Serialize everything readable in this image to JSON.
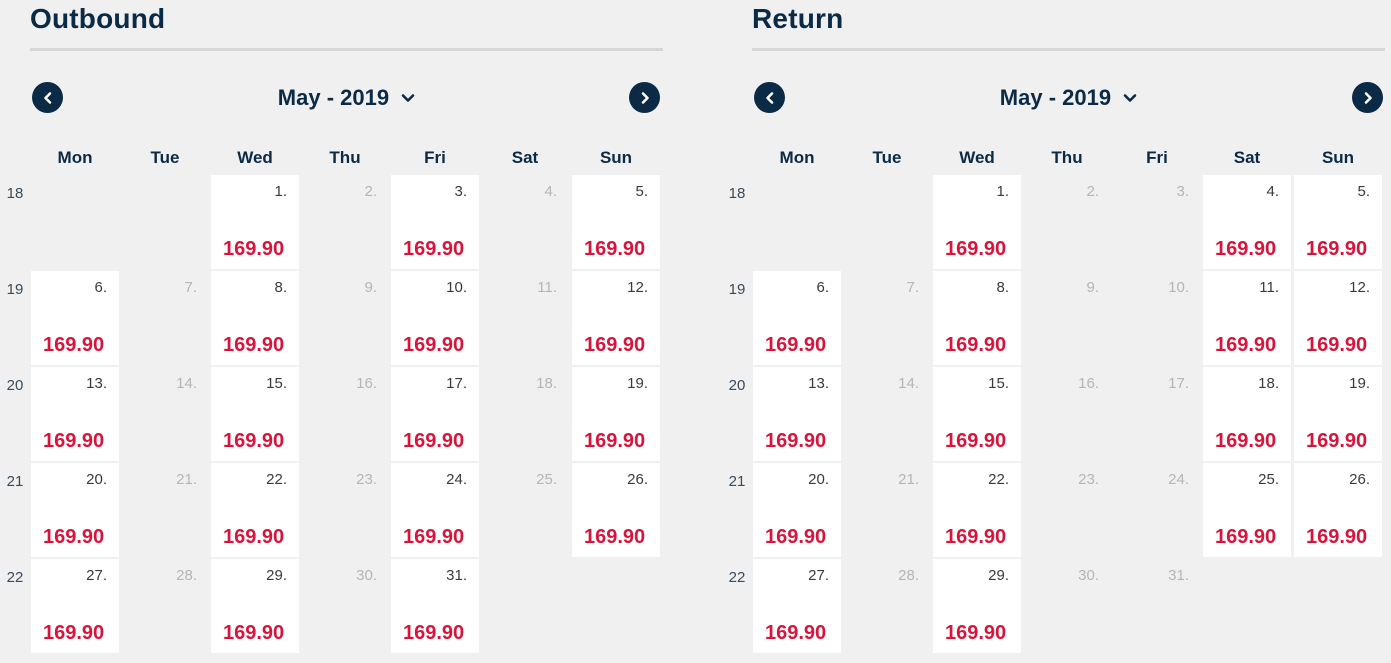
{
  "outbound": {
    "title": "Outbound",
    "month_label": "May - 2019",
    "prev_icon": "chevron-left-icon",
    "next_icon": "chevron-right-icon",
    "weekdays": [
      "Mon",
      "Tue",
      "Wed",
      "Thu",
      "Fri",
      "Sat",
      "Sun"
    ],
    "weeks": [
      {
        "num": "18",
        "days": [
          {
            "day": "",
            "price": "",
            "state": "empty"
          },
          {
            "day": "",
            "price": "",
            "state": "empty"
          },
          {
            "day": "1.",
            "price": "169.90",
            "state": "available"
          },
          {
            "day": "2.",
            "price": "",
            "state": "unavailable"
          },
          {
            "day": "3.",
            "price": "169.90",
            "state": "available"
          },
          {
            "day": "4.",
            "price": "",
            "state": "unavailable"
          },
          {
            "day": "5.",
            "price": "169.90",
            "state": "available"
          }
        ]
      },
      {
        "num": "19",
        "days": [
          {
            "day": "6.",
            "price": "169.90",
            "state": "available"
          },
          {
            "day": "7.",
            "price": "",
            "state": "unavailable"
          },
          {
            "day": "8.",
            "price": "169.90",
            "state": "available"
          },
          {
            "day": "9.",
            "price": "",
            "state": "unavailable"
          },
          {
            "day": "10.",
            "price": "169.90",
            "state": "available"
          },
          {
            "day": "11.",
            "price": "",
            "state": "unavailable"
          },
          {
            "day": "12.",
            "price": "169.90",
            "state": "available"
          }
        ]
      },
      {
        "num": "20",
        "days": [
          {
            "day": "13.",
            "price": "169.90",
            "state": "available"
          },
          {
            "day": "14.",
            "price": "",
            "state": "unavailable"
          },
          {
            "day": "15.",
            "price": "169.90",
            "state": "available"
          },
          {
            "day": "16.",
            "price": "",
            "state": "unavailable"
          },
          {
            "day": "17.",
            "price": "169.90",
            "state": "available"
          },
          {
            "day": "18.",
            "price": "",
            "state": "unavailable"
          },
          {
            "day": "19.",
            "price": "169.90",
            "state": "available"
          }
        ]
      },
      {
        "num": "21",
        "days": [
          {
            "day": "20.",
            "price": "169.90",
            "state": "available"
          },
          {
            "day": "21.",
            "price": "",
            "state": "unavailable"
          },
          {
            "day": "22.",
            "price": "169.90",
            "state": "available"
          },
          {
            "day": "23.",
            "price": "",
            "state": "unavailable"
          },
          {
            "day": "24.",
            "price": "169.90",
            "state": "available"
          },
          {
            "day": "25.",
            "price": "",
            "state": "unavailable"
          },
          {
            "day": "26.",
            "price": "169.90",
            "state": "available"
          }
        ]
      },
      {
        "num": "22",
        "days": [
          {
            "day": "27.",
            "price": "169.90",
            "state": "available"
          },
          {
            "day": "28.",
            "price": "",
            "state": "unavailable"
          },
          {
            "day": "29.",
            "price": "169.90",
            "state": "available"
          },
          {
            "day": "30.",
            "price": "",
            "state": "unavailable"
          },
          {
            "day": "31.",
            "price": "169.90",
            "state": "available"
          },
          {
            "day": "",
            "price": "",
            "state": "empty"
          },
          {
            "day": "",
            "price": "",
            "state": "empty"
          }
        ]
      }
    ]
  },
  "return": {
    "title": "Return",
    "month_label": "May - 2019",
    "prev_icon": "chevron-left-icon",
    "next_icon": "chevron-right-icon",
    "weekdays": [
      "Mon",
      "Tue",
      "Wed",
      "Thu",
      "Fri",
      "Sat",
      "Sun"
    ],
    "weeks": [
      {
        "num": "18",
        "days": [
          {
            "day": "",
            "price": "",
            "state": "empty"
          },
          {
            "day": "",
            "price": "",
            "state": "empty"
          },
          {
            "day": "1.",
            "price": "169.90",
            "state": "available"
          },
          {
            "day": "2.",
            "price": "",
            "state": "unavailable"
          },
          {
            "day": "3.",
            "price": "",
            "state": "unavailable"
          },
          {
            "day": "4.",
            "price": "169.90",
            "state": "available"
          },
          {
            "day": "5.",
            "price": "169.90",
            "state": "available"
          }
        ]
      },
      {
        "num": "19",
        "days": [
          {
            "day": "6.",
            "price": "169.90",
            "state": "available"
          },
          {
            "day": "7.",
            "price": "",
            "state": "unavailable"
          },
          {
            "day": "8.",
            "price": "169.90",
            "state": "available"
          },
          {
            "day": "9.",
            "price": "",
            "state": "unavailable"
          },
          {
            "day": "10.",
            "price": "",
            "state": "unavailable"
          },
          {
            "day": "11.",
            "price": "169.90",
            "state": "available"
          },
          {
            "day": "12.",
            "price": "169.90",
            "state": "available"
          }
        ]
      },
      {
        "num": "20",
        "days": [
          {
            "day": "13.",
            "price": "169.90",
            "state": "available"
          },
          {
            "day": "14.",
            "price": "",
            "state": "unavailable"
          },
          {
            "day": "15.",
            "price": "169.90",
            "state": "available"
          },
          {
            "day": "16.",
            "price": "",
            "state": "unavailable"
          },
          {
            "day": "17.",
            "price": "",
            "state": "unavailable"
          },
          {
            "day": "18.",
            "price": "169.90",
            "state": "available"
          },
          {
            "day": "19.",
            "price": "169.90",
            "state": "available"
          }
        ]
      },
      {
        "num": "21",
        "days": [
          {
            "day": "20.",
            "price": "169.90",
            "state": "available"
          },
          {
            "day": "21.",
            "price": "",
            "state": "unavailable"
          },
          {
            "day": "22.",
            "price": "169.90",
            "state": "available"
          },
          {
            "day": "23.",
            "price": "",
            "state": "unavailable"
          },
          {
            "day": "24.",
            "price": "",
            "state": "unavailable"
          },
          {
            "day": "25.",
            "price": "169.90",
            "state": "available"
          },
          {
            "day": "26.",
            "price": "169.90",
            "state": "available"
          }
        ]
      },
      {
        "num": "22",
        "days": [
          {
            "day": "27.",
            "price": "169.90",
            "state": "available"
          },
          {
            "day": "28.",
            "price": "",
            "state": "unavailable"
          },
          {
            "day": "29.",
            "price": "169.90",
            "state": "available"
          },
          {
            "day": "30.",
            "price": "",
            "state": "unavailable"
          },
          {
            "day": "31.",
            "price": "",
            "state": "unavailable"
          },
          {
            "day": "",
            "price": "",
            "state": "empty"
          },
          {
            "day": "",
            "price": "",
            "state": "empty"
          }
        ]
      }
    ]
  },
  "colors": {
    "navy": "#0b2a45",
    "price_red": "#d7143c",
    "background": "#f0f0f0",
    "cell_available": "#ffffff",
    "day_unavailable": "#b5b5b5"
  }
}
